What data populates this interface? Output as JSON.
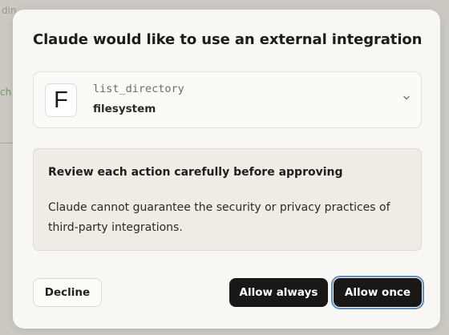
{
  "background": {
    "fragment_1": "din",
    "fragment_2": "ch"
  },
  "dialog": {
    "title": "Claude would like to use an external integration",
    "integration": {
      "icon_letter": "F",
      "tool_name": "list_directory",
      "server_name": "filesystem",
      "expand_icon": "chevron-down-icon"
    },
    "warning": {
      "title": "Review each action carefully before approving",
      "body": "Claude cannot guarantee the security or privacy practices of third-party integrations."
    },
    "buttons": {
      "decline": "Decline",
      "allow_always": "Allow always",
      "allow_once": "Allow once"
    }
  },
  "colors": {
    "primary_button": "#191816",
    "focus_ring": "#5d90c8",
    "warning_bg": "#f0ece5"
  }
}
